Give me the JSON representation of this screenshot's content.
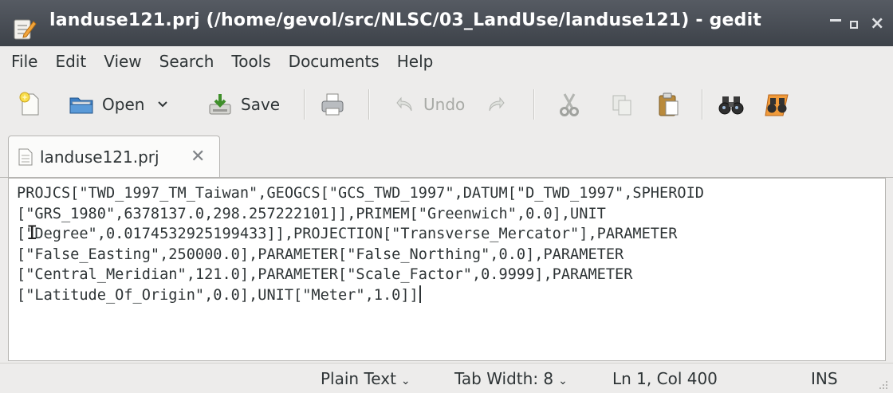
{
  "window": {
    "title": "landuse121.prj (/home/gevol/src/NLSC/03_LandUse/landuse121) - gedit",
    "minimize": "_",
    "maximize": "",
    "close": "×"
  },
  "menu": [
    "File",
    "Edit",
    "View",
    "Search",
    "Tools",
    "Documents",
    "Help"
  ],
  "toolbar": {
    "new": "",
    "open": "Open",
    "save": "Save",
    "undo": "Undo",
    "icons": [
      "new-document-icon",
      "folder-open-icon",
      "open-dropdown-icon",
      "save-icon",
      "print-icon",
      "undo-icon",
      "redo-icon",
      "cut-icon",
      "copy-icon",
      "paste-icon",
      "find-icon",
      "find-replace-icon"
    ]
  },
  "tab": {
    "label": "landuse121.prj",
    "close": "✕"
  },
  "editor": {
    "lines": [
      "PROJCS[\"TWD_1997_TM_Taiwan\",GEOGCS[\"GCS_TWD_1997\",DATUM[\"D_TWD_1997\",SPHEROID",
      "[\"GRS_1980\",6378137.0,298.257222101]],PRIMEM[\"Greenwich\",0.0],UNIT",
      "[\"Degree\",0.0174532925199433]],PROJECTION[\"Transverse_Mercator\"],PARAMETER",
      "[\"False_Easting\",250000.0],PARAMETER[\"False_Northing\",0.0],PARAMETER",
      "[\"Central_Meridian\",121.0],PARAMETER[\"Scale_Factor\",0.9999],PARAMETER",
      "[\"Latitude_Of_Origin\",0.0],UNIT[\"Meter\",1.0]]"
    ]
  },
  "status": {
    "language": "Plain Text",
    "tab_width": "Tab Width:  8",
    "position": "Ln 1, Col 400",
    "mode": "INS"
  },
  "colors": {
    "titlebar": "#4a4f56",
    "chrome": "#edeceb",
    "editor_bg": "#ffffff",
    "text": "#2e3436"
  }
}
